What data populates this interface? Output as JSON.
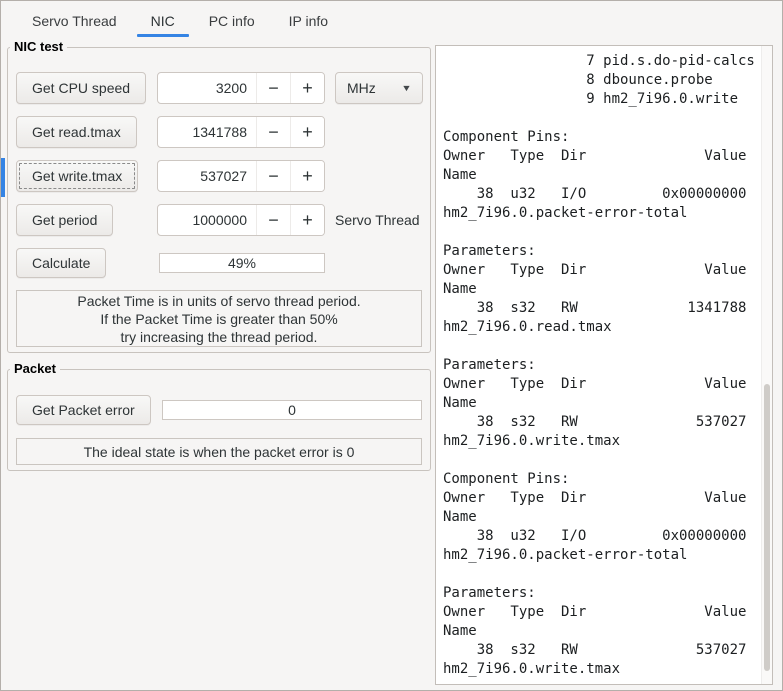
{
  "tabs": {
    "items": [
      {
        "label": "Servo Thread"
      },
      {
        "label": "NIC"
      },
      {
        "label": "PC info"
      },
      {
        "label": "IP info"
      }
    ]
  },
  "nic_test": {
    "legend": "NIC test",
    "rows": [
      {
        "button": "Get CPU speed",
        "value": "3200"
      },
      {
        "button": "Get read.tmax",
        "value": "1341788"
      },
      {
        "button": "Get write.tmax",
        "value": "537027"
      },
      {
        "button": "Get period",
        "value": "1000000"
      }
    ],
    "unit_selected": "MHz",
    "servo_thread_label": "Servo Thread",
    "calculate_button": "Calculate",
    "progress_text": "49%",
    "note": "Packet Time is in units of servo thread period.\nIf the Packet Time is greater than 50%\ntry increasing the thread period."
  },
  "packet": {
    "legend": "Packet",
    "button": "Get Packet error",
    "value": "0",
    "note": "The ideal state is when the packet error is 0"
  },
  "terminal": {
    "text": "                 7 pid.s.do-pid-calcs\n                 8 dbounce.probe\n                 9 hm2_7i96.0.write\n\nComponent Pins:\nOwner   Type  Dir              Value\nName\n    38  u32   I/O         0x00000000\nhm2_7i96.0.packet-error-total\n\nParameters:\nOwner   Type  Dir              Value\nName\n    38  s32   RW             1341788\nhm2_7i96.0.read.tmax\n\nParameters:\nOwner   Type  Dir              Value\nName\n    38  s32   RW              537027\nhm2_7i96.0.write.tmax\n\nComponent Pins:\nOwner   Type  Dir              Value\nName\n    38  u32   I/O         0x00000000\nhm2_7i96.0.packet-error-total\n\nParameters:\nOwner   Type  Dir              Value\nName\n    38  s32   RW              537027\nhm2_7i96.0.write.tmax"
  },
  "icons": {
    "minus": "−",
    "plus": "+",
    "dropdown_arrow": "▼"
  },
  "colors": {
    "accent": "#3584e4"
  }
}
